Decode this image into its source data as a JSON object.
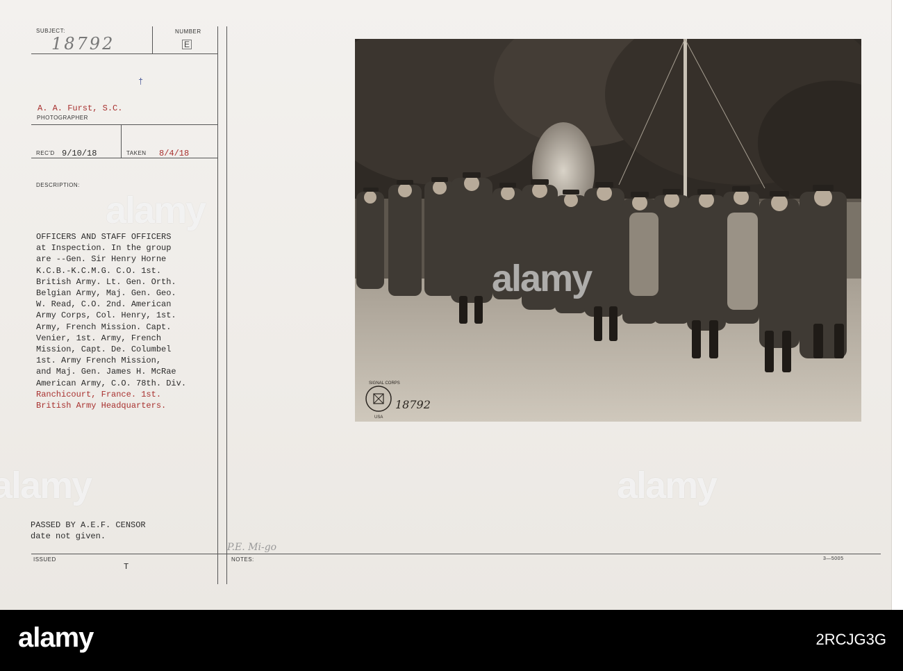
{
  "header": {
    "subject_label": "SUBJECT:",
    "subject_number": "18792",
    "number_label": "NUMBER",
    "number_code": "E",
    "photographer_name": "A. A. Furst, S.C.",
    "photographer_label": "PHOTOGRAPHER",
    "recd_label": "REC'D",
    "recd_date": "9/10/18",
    "taken_label": "TAKEN",
    "taken_date": "8/4/18",
    "description_label": "DESCRIPTION:"
  },
  "description_lines": [
    "OFFICERS AND STAFF OFFICERS",
    "at Inspection. In the group",
    "are --Gen. Sir Henry Horne",
    "K.C.B.-K.C.M.G. C.O. 1st.",
    "British Army. Lt. Gen. Orth.",
    "Belgian Army, Maj. Gen. Geo.",
    "W. Read, C.O. 2nd. American",
    "Army Corps, Col. Henry, 1st.",
    "Army, French Mission. Capt.",
    "Venier, 1st. Army, French",
    "Mission, Capt. De. Columbel",
    "1st. Army French Mission,",
    "and Maj. Gen. James H. McRae",
    "American Army, C.O. 78th. Div.",
    "Ranchicourt, France. 1st.",
    "British Army Headquarters."
  ],
  "censor": {
    "line1": "PASSED BY A.E.F. CENSOR",
    "line2": "date not given."
  },
  "footer": {
    "issued_label": "ISSUED",
    "issued_mark": "T",
    "notes_label": "NOTES:",
    "notes_handwriting": "P.E. Mi-go",
    "form_code": "3—5005"
  },
  "photo": {
    "stamp_number": "18792",
    "stamp_text_top": "SIGNAL CORPS",
    "stamp_text_bottom": "USA"
  },
  "watermark": {
    "brand": "alamy",
    "image_id": "2RCJG3G"
  },
  "colors": {
    "card": "#efece8",
    "ink": "#2b2b2b",
    "red_ink": "#a8312f",
    "photo_sepia": "#5a5148"
  }
}
